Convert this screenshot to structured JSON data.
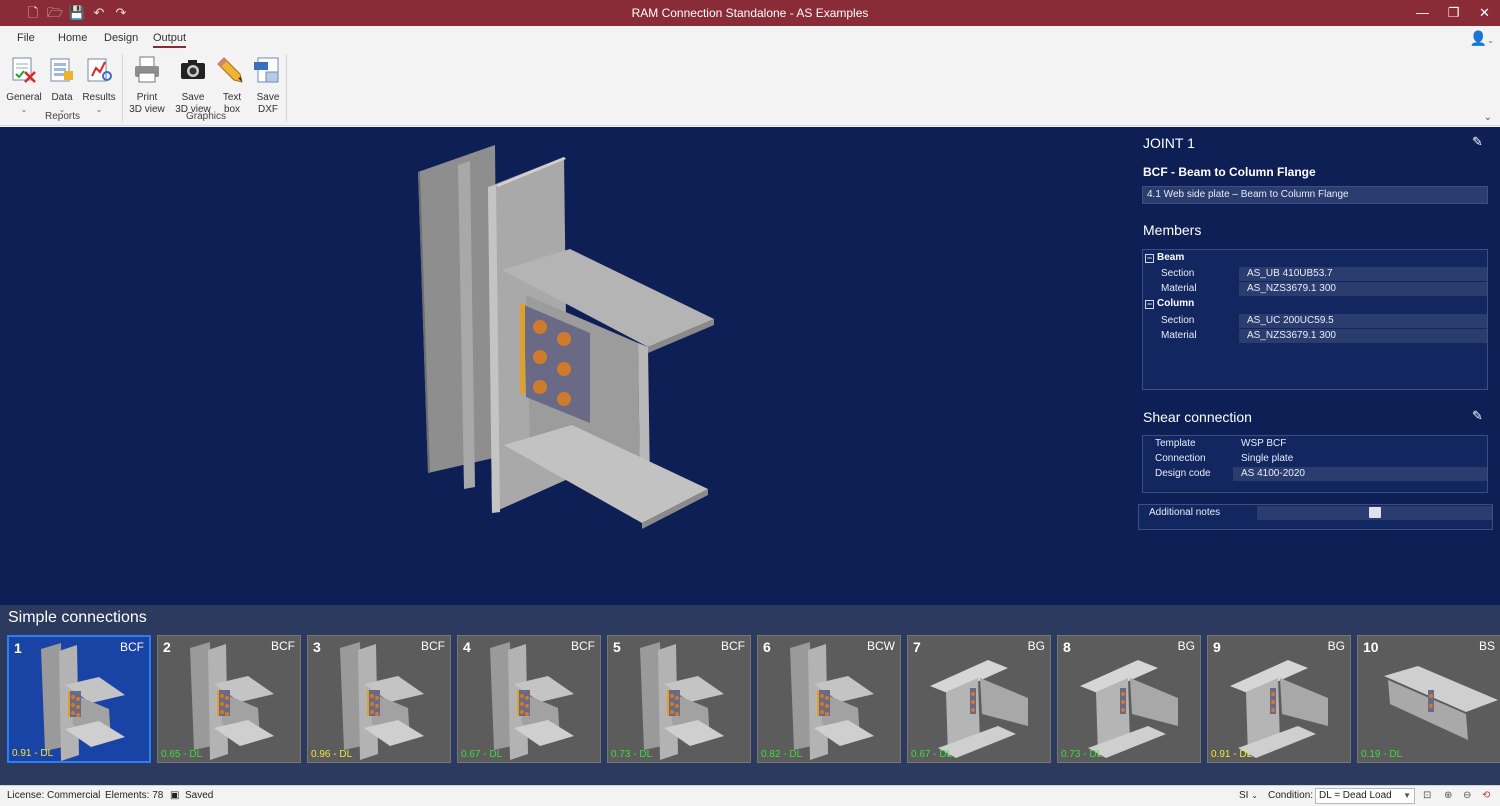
{
  "app": {
    "title": "RAM Connection Standalone - AS Examples"
  },
  "menu": {
    "tabs": [
      "File",
      "Home",
      "Design",
      "Output"
    ],
    "active": "Output"
  },
  "ribbon": {
    "general": "General",
    "data": "Data",
    "results": "Results",
    "print_3d": "Print\n3D view",
    "save_3d": "Save\n3D view",
    "text_box": "Text\nbox",
    "save_dxf": "Save\nDXF",
    "group_reports": "Reports",
    "group_graphics": "Graphics"
  },
  "panel": {
    "joint_title": "JOINT 1",
    "connection_type": "BCF - Beam to Column Flange",
    "connection_desc": "4.1 Web side plate – Beam to Column Flange",
    "members_title": "Members",
    "beam": {
      "label": "Beam",
      "section_k": "Section",
      "section_v": "AS_UB 410UB53.7",
      "material_k": "Material",
      "material_v": "AS_NZS3679.1 300"
    },
    "column": {
      "label": "Column",
      "section_k": "Section",
      "section_v": "AS_UC 200UC59.5",
      "material_k": "Material",
      "material_v": "AS_NZS3679.1 300"
    },
    "shear_title": "Shear connection",
    "shear": {
      "template_k": "Template",
      "template_v": "WSP BCF",
      "connection_k": "Connection",
      "connection_v": "Single plate",
      "code_k": "Design code",
      "code_v": "AS 4100-2020"
    },
    "notes_k": "Additional notes"
  },
  "strip": {
    "title": "Simple connections",
    "items": [
      {
        "num": "1",
        "type": "BCF",
        "ratio": "0.91 - DL"
      },
      {
        "num": "2",
        "type": "BCF",
        "ratio": "0.65 - DL"
      },
      {
        "num": "3",
        "type": "BCF",
        "ratio": "0.96 - DL"
      },
      {
        "num": "4",
        "type": "BCF",
        "ratio": "0.67 - DL"
      },
      {
        "num": "5",
        "type": "BCF",
        "ratio": "0.73 - DL"
      },
      {
        "num": "6",
        "type": "BCW",
        "ratio": "0.82 - DL"
      },
      {
        "num": "7",
        "type": "BG",
        "ratio": "0.67 - DL"
      },
      {
        "num": "8",
        "type": "BG",
        "ratio": "0.73 - DL"
      },
      {
        "num": "9",
        "type": "BG",
        "ratio": "0.91 - DL"
      },
      {
        "num": "10",
        "type": "BS",
        "ratio": "0.19 - DL"
      }
    ],
    "selected": "1"
  },
  "status": {
    "license": "License: Commercial",
    "elements": "Elements: 78",
    "saved": "Saved",
    "units": "SI",
    "condition_label": "Condition:",
    "condition_value": "DL = Dead Load"
  },
  "colors": {
    "titlebar": "#8a2c37",
    "viewport": "#0e1f55",
    "ratio_green": "#3ddc3d",
    "ratio_yellow": "#f1e53a"
  }
}
